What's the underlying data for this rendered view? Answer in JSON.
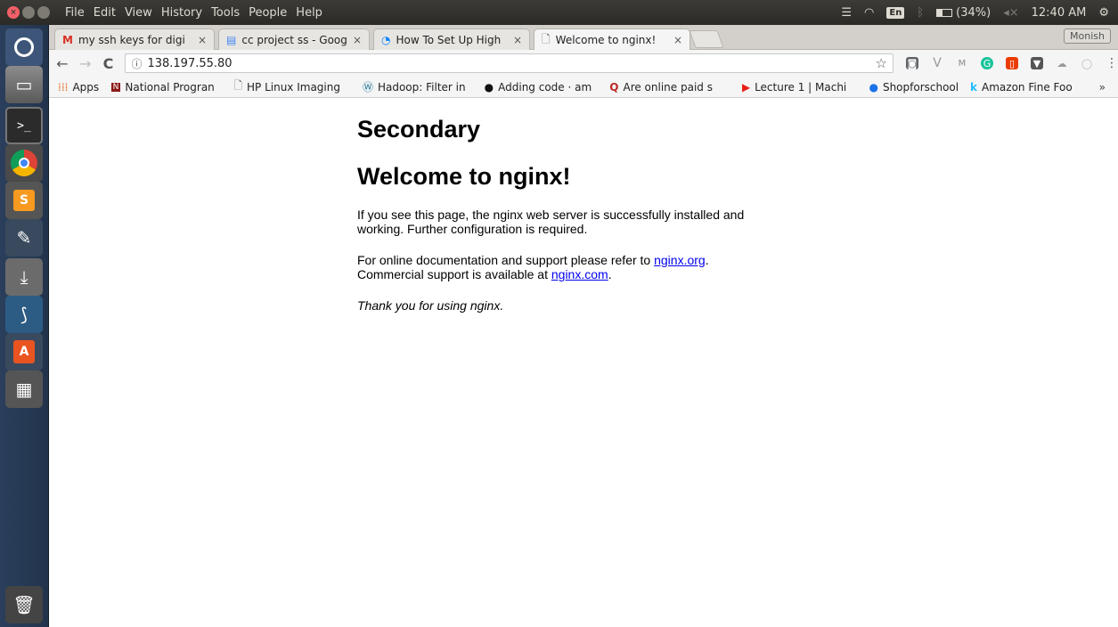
{
  "system_panel": {
    "menu": [
      "File",
      "Edit",
      "View",
      "History",
      "Tools",
      "People",
      "Help"
    ],
    "keyboard_layout": "En",
    "battery": "(34%)",
    "clock": "12:40 AM"
  },
  "launcher": {
    "items": [
      "ubuntu-dash-icon",
      "files-icon",
      "terminal-icon",
      "chrome-icon",
      "sublime-text-icon",
      "settings-tools-icon",
      "installer-icon",
      "mysql-workbench-icon",
      "software-center-icon",
      "calculator-icon",
      "trash-icon"
    ]
  },
  "browser": {
    "tabs": [
      {
        "title": "my ssh keys for digi",
        "icon": "gmail-icon"
      },
      {
        "title": "cc project ss - Goog",
        "icon": "google-docs-icon"
      },
      {
        "title": "How To Set Up High",
        "icon": "digitalocean-icon"
      },
      {
        "title": "Welcome to nginx!",
        "icon": "page-icon"
      }
    ],
    "tab_close": "×",
    "profile": "Monish",
    "url": "138.197.55.80",
    "bookmarks": [
      {
        "label": "Apps",
        "icon": "apps-grid-icon"
      },
      {
        "label": "National Progran",
        "icon": "nptel-icon"
      },
      {
        "label": "HP Linux Imaging",
        "icon": "page-icon"
      },
      {
        "label": "Hadoop: Filter in",
        "icon": "wordpress-icon"
      },
      {
        "label": "Adding code · am",
        "icon": "github-icon"
      },
      {
        "label": "Are online paid s",
        "icon": "quora-icon"
      },
      {
        "label": "Lecture 1 | Machi",
        "icon": "youtube-icon"
      },
      {
        "label": "Shopforschool",
        "icon": "globe-icon"
      },
      {
        "label": "Amazon Fine Foo",
        "icon": "kaggle-icon"
      }
    ],
    "more": "»"
  },
  "page": {
    "heading_secondary": "Secondary",
    "heading_welcome": "Welcome to nginx!",
    "para1": "If you see this page, the nginx web server is successfully installed and working. Further configuration is required.",
    "para2_prefix": "For online documentation and support please refer to ",
    "link_org": "nginx.org",
    "para2_mid": ".",
    "para2_line2": "Commercial support is available at ",
    "link_com": "nginx.com",
    "para2_end": ".",
    "thanks": "Thank you for using nginx."
  }
}
